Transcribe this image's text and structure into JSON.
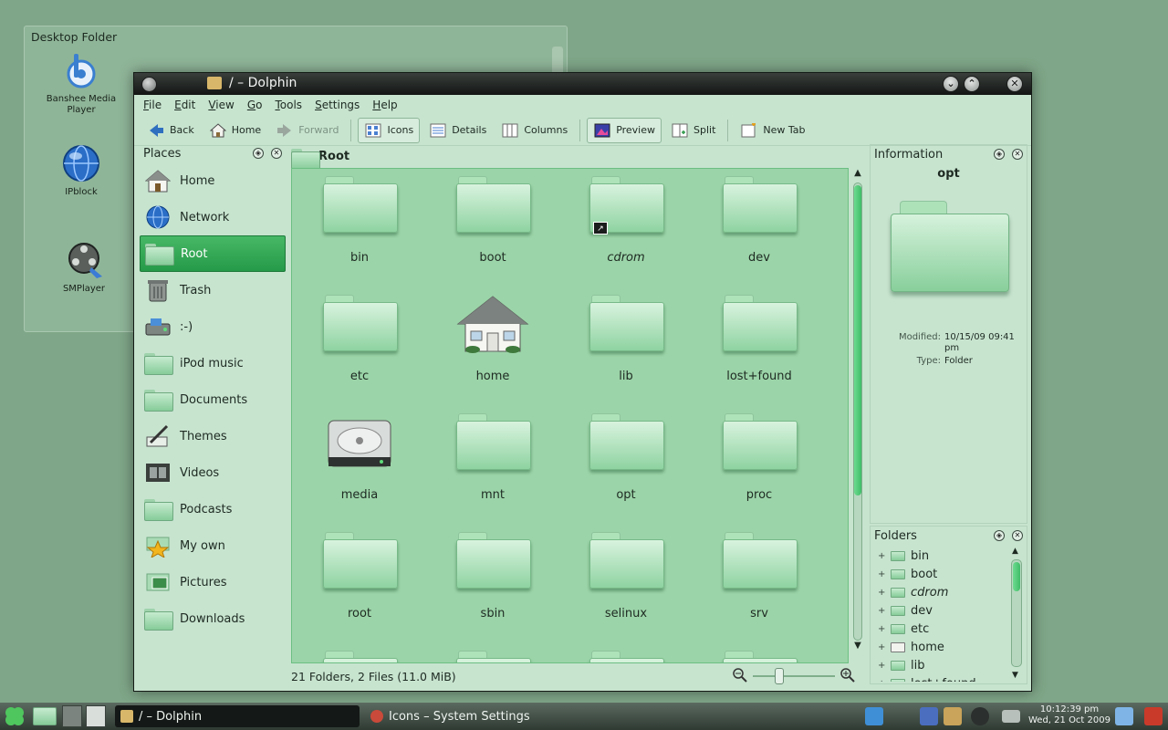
{
  "colors": {
    "accent": "#259a48",
    "folder": "#9bd4a8",
    "window_bg": "#c7e4cf",
    "desktop": "#7fa688"
  },
  "desktop_folder": {
    "title": "Desktop Folder",
    "icons": [
      {
        "label": "Banshee Media Player",
        "icon": "banshee-icon"
      },
      {
        "label": "IPblock",
        "icon": "globe-icon"
      },
      {
        "label": "SMPlayer",
        "icon": "film-reel-icon"
      }
    ]
  },
  "window": {
    "title": "/ – Dolphin",
    "menu": [
      "File",
      "Edit",
      "View",
      "Go",
      "Tools",
      "Settings",
      "Help"
    ],
    "menu_mnemonics": [
      "F",
      "E",
      "V",
      "G",
      "T",
      "S",
      "H"
    ],
    "toolbar": {
      "back": "Back",
      "home": "Home",
      "forward": "Forward",
      "icons": "Icons",
      "details": "Details",
      "columns": "Columns",
      "preview": "Preview",
      "split": "Split",
      "new_tab": "New Tab"
    },
    "places": {
      "title": "Places",
      "items": [
        {
          "label": "Home",
          "icon": "house-icon"
        },
        {
          "label": "Network",
          "icon": "globe-icon"
        },
        {
          "label": "Root",
          "icon": "folder-icon",
          "selected": true
        },
        {
          "label": "Trash",
          "icon": "trash-icon"
        },
        {
          "label": ":-)",
          "icon": "drive-icon"
        },
        {
          "label": "iPod music",
          "icon": "folder-icon"
        },
        {
          "label": "Documents",
          "icon": "folder-icon"
        },
        {
          "label": "Themes",
          "icon": "brush-icon"
        },
        {
          "label": "Videos",
          "icon": "film-icon"
        },
        {
          "label": "Podcasts",
          "icon": "folder-icon"
        },
        {
          "label": "My own",
          "icon": "star-icon"
        },
        {
          "label": "Pictures",
          "icon": "pictures-icon"
        },
        {
          "label": "Downloads",
          "icon": "folder-icon"
        }
      ]
    },
    "breadcrumb": "Root",
    "files": [
      {
        "name": "bin",
        "type": "folder"
      },
      {
        "name": "boot",
        "type": "folder"
      },
      {
        "name": "cdrom",
        "type": "folder",
        "link": true
      },
      {
        "name": "dev",
        "type": "folder"
      },
      {
        "name": "etc",
        "type": "folder"
      },
      {
        "name": "home",
        "type": "house"
      },
      {
        "name": "lib",
        "type": "folder"
      },
      {
        "name": "lost+found",
        "type": "folder"
      },
      {
        "name": "media",
        "type": "drive"
      },
      {
        "name": "mnt",
        "type": "folder"
      },
      {
        "name": "opt",
        "type": "folder"
      },
      {
        "name": "proc",
        "type": "folder"
      },
      {
        "name": "root",
        "type": "folder"
      },
      {
        "name": "sbin",
        "type": "folder"
      },
      {
        "name": "selinux",
        "type": "folder"
      },
      {
        "name": "srv",
        "type": "folder"
      }
    ],
    "status": "21 Folders, 2 Files (11.0 MiB)",
    "info_panel": {
      "title": "Information",
      "name": "opt",
      "modified_label": "Modified:",
      "modified_value": "10/15/09 09:41 pm",
      "type_label": "Type:",
      "type_value": "Folder"
    },
    "folders_panel": {
      "title": "Folders",
      "items": [
        {
          "label": "bin"
        },
        {
          "label": "boot"
        },
        {
          "label": "cdrom",
          "link": true
        },
        {
          "label": "dev"
        },
        {
          "label": "etc"
        },
        {
          "label": "home",
          "house": true
        },
        {
          "label": "lib"
        },
        {
          "label": "lost+found"
        }
      ]
    }
  },
  "taskbar": {
    "tasks": [
      {
        "label": "/ – Dolphin",
        "active": true
      },
      {
        "label": "Icons – System Settings",
        "active": false
      }
    ],
    "clock_time": "10:12:39 pm",
    "clock_date": "Wed, 21 Oct 2009"
  }
}
